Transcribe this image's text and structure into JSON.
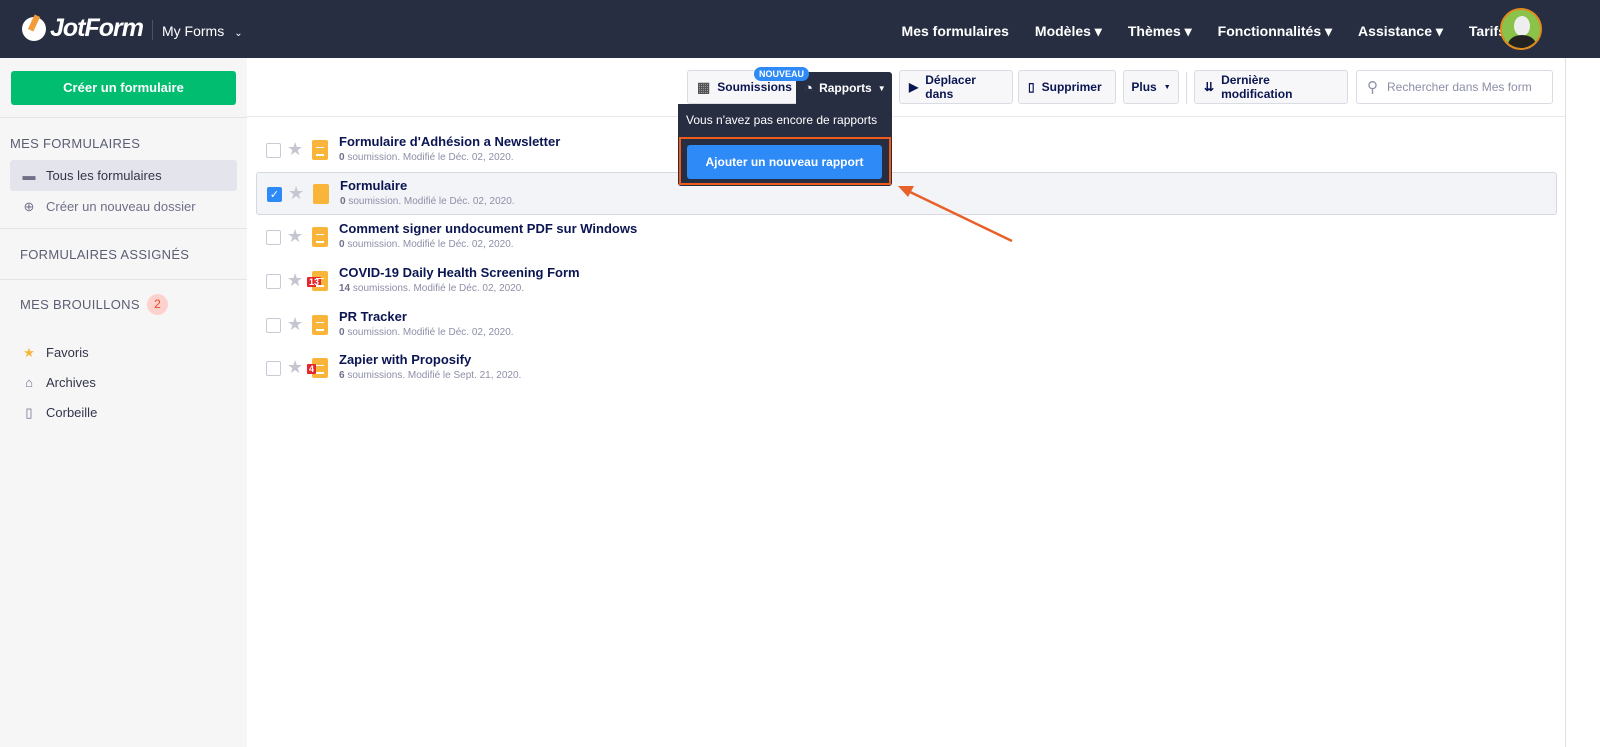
{
  "header": {
    "logo": "JotForm",
    "app_switch": "My Forms",
    "nav": [
      "Mes formulaires",
      "Modèles ▾",
      "Thèmes ▾",
      "Fonctionnalités ▾",
      "Assistance ▾",
      "Tarifs"
    ]
  },
  "sidebar": {
    "create": "Créer un formulaire",
    "mes_formulaires": "MES FORMULAIRES",
    "all_forms": "Tous les formulaires",
    "new_folder": "Créer un nouveau dossier",
    "assigned": "FORMULAIRES ASSIGNÉS",
    "drafts": "MES BROUILLONS",
    "drafts_count": "2",
    "favorites": "Favoris",
    "archives": "Archives",
    "trash": "Corbeille"
  },
  "toolbar": {
    "submissions": "Soumissions",
    "new_badge": "NOUVEAU",
    "reports": "Rapports",
    "move": "Déplacer dans",
    "delete": "Supprimer",
    "more": "Plus",
    "sort": "Dernière modification",
    "search_placeholder": "Rechercher dans Mes form"
  },
  "reports_dropdown": {
    "message": "Vous n'avez pas encore de rapports",
    "add": "Ajouter un nouveau rapport"
  },
  "accent": "#2d8af6",
  "highlight": "#f05a1a",
  "forms": [
    {
      "title": "Formulaire d'Adhésion a Newsletter",
      "count": "0",
      "meta": " soumission. Modifié le Déc. 02, 2020.",
      "checked": false
    },
    {
      "title": "Formulaire",
      "count": "0",
      "meta": " soumission. Modifié le Déc. 02, 2020.",
      "checked": true
    },
    {
      "title": "Comment signer undocument PDF sur Windows",
      "count": "0",
      "meta": " soumission. Modifié le Déc. 02, 2020.",
      "checked": false
    },
    {
      "title": "COVID-19 Daily Health Screening Form",
      "count": "14",
      "meta": " soumissions. Modifié le Déc. 02, 2020.",
      "badge": "13",
      "checked": false
    },
    {
      "title": "PR Tracker",
      "count": "0",
      "meta": " soumission. Modifié le Déc. 02, 2020.",
      "checked": false
    },
    {
      "title": "Zapier with Proposify",
      "count": "6",
      "meta": " soumissions. Modifié le Sept. 21, 2020.",
      "badge": "4",
      "checked": false
    }
  ]
}
